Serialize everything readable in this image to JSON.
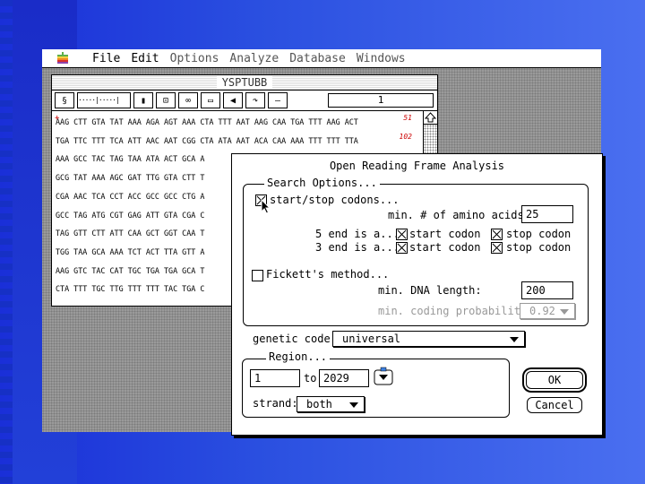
{
  "menubar": {
    "items": [
      "File",
      "Edit",
      "Options",
      "Analyze",
      "Database",
      "Windows"
    ]
  },
  "docwindow": {
    "title": "YSPTUBB",
    "position_field": "1",
    "sequence_rows": [
      "AAG CTT GTA TAT AAA AGA AGT AAA CTA TTT AAT AAG CAA TGA TTT AAG ACT",
      "TGA TTC TTT TCA ATT AAC AAT CGG CTA ATA AAT ACA CAA AAA TTT TTT TTA",
      "AAA GCC TAC TAG TAA ATA ACT GCA A",
      "GCG TAT AAA AGC GAT TTG GTA CTT T",
      "CGA AAC TCA CCT ACC GCC GCC CTG A",
      "GCC TAG ATG CGT GAG ATT GTA CGA C",
      "TAG GTT CTT ATT CAA GCT GGT CAA T",
      "TGG TAA GCA AAA TCT ACT TTA GTT A",
      "AAG GTC TAC CAT TGC TGA TGA GCA T",
      "CTA TTT TGC TTG TTT TTT TAC TGA C"
    ],
    "row_numbers": [
      "51",
      "102"
    ]
  },
  "dialog": {
    "title": "Open Reading Frame Analysis",
    "search_options_label": "Search Options...",
    "start_stop_label": "start/stop codons...",
    "start_stop_checked": true,
    "min_amino_label": "min. # of amino acids:",
    "min_amino_value": "25",
    "end5_label": "5 end is a...",
    "end3_label": "3 end is a...",
    "start_codon_label": "start codon",
    "stop_codon_label": "stop codon",
    "fickett_label": "Fickett's method...",
    "fickett_checked": false,
    "min_dna_label": "min. DNA length:",
    "min_dna_value": "200",
    "min_coding_label": "min. coding probability:",
    "min_coding_value": "0.92",
    "genetic_code_label": "genetic code:",
    "genetic_code_value": "universal",
    "region_label": "Region...",
    "region_from": "1",
    "region_to_label": "to",
    "region_to": "2029",
    "strand_label": "strand:",
    "strand_value": "both",
    "ok_label": "OK",
    "cancel_label": "Cancel"
  }
}
